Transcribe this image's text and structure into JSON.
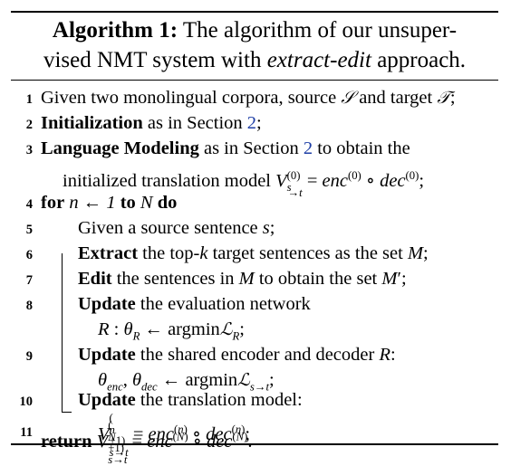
{
  "caption": {
    "label": "Algorithm 1:",
    "line1_rest": " The algorithm of our unsuper-",
    "line2_pre": "vised NMT system with ",
    "line2_em": "extract-edit",
    "line2_post": " approach."
  },
  "lines": [
    {
      "num": "1",
      "text": "Given two monolingual corpora, source 𝒮 and target 𝒯;"
    },
    {
      "num": "2",
      "kw": "Initialization",
      "text": " as in Section ",
      "ref": "2",
      "tail": ";"
    },
    {
      "num": "3",
      "kw": "Language Modeling",
      "text": " as in Section ",
      "ref": "2",
      "tail": " to obtain the",
      "cont": "initialized translation model V(0)s→t = enc(0) ∘ dec(0);"
    },
    {
      "num": "4",
      "text": "for n ← 1 to N do"
    },
    {
      "num": "5",
      "text": "Given a source sentence s;"
    },
    {
      "num": "6",
      "kw": "Extract",
      "text": " the top-k target sentences as the set M;"
    },
    {
      "num": "7",
      "kw": "Edit",
      "text": " the sentences in M to obtain the set M′;"
    },
    {
      "num": "8",
      "kw": "Update",
      "text": " the evaluation network",
      "cont": "R : θR ← argminℒR;"
    },
    {
      "num": "9",
      "kw": "Update",
      "text": " the shared encoder and decoder R:",
      "cont": "θenc, θdec ← argminℒs→t;"
    },
    {
      "num": "10",
      "kw": "Update",
      "text": " the translation model:",
      "cont": "V(n+1)s→t = enc(n) ∘ dec(n);"
    },
    {
      "num": "11",
      "text": "return V(N+1)s→t = enc(N) ∘ dec(N)."
    }
  ],
  "colors": {
    "text": "#000000",
    "ref_link": "#1f3fa6",
    "background": "#ffffff"
  }
}
